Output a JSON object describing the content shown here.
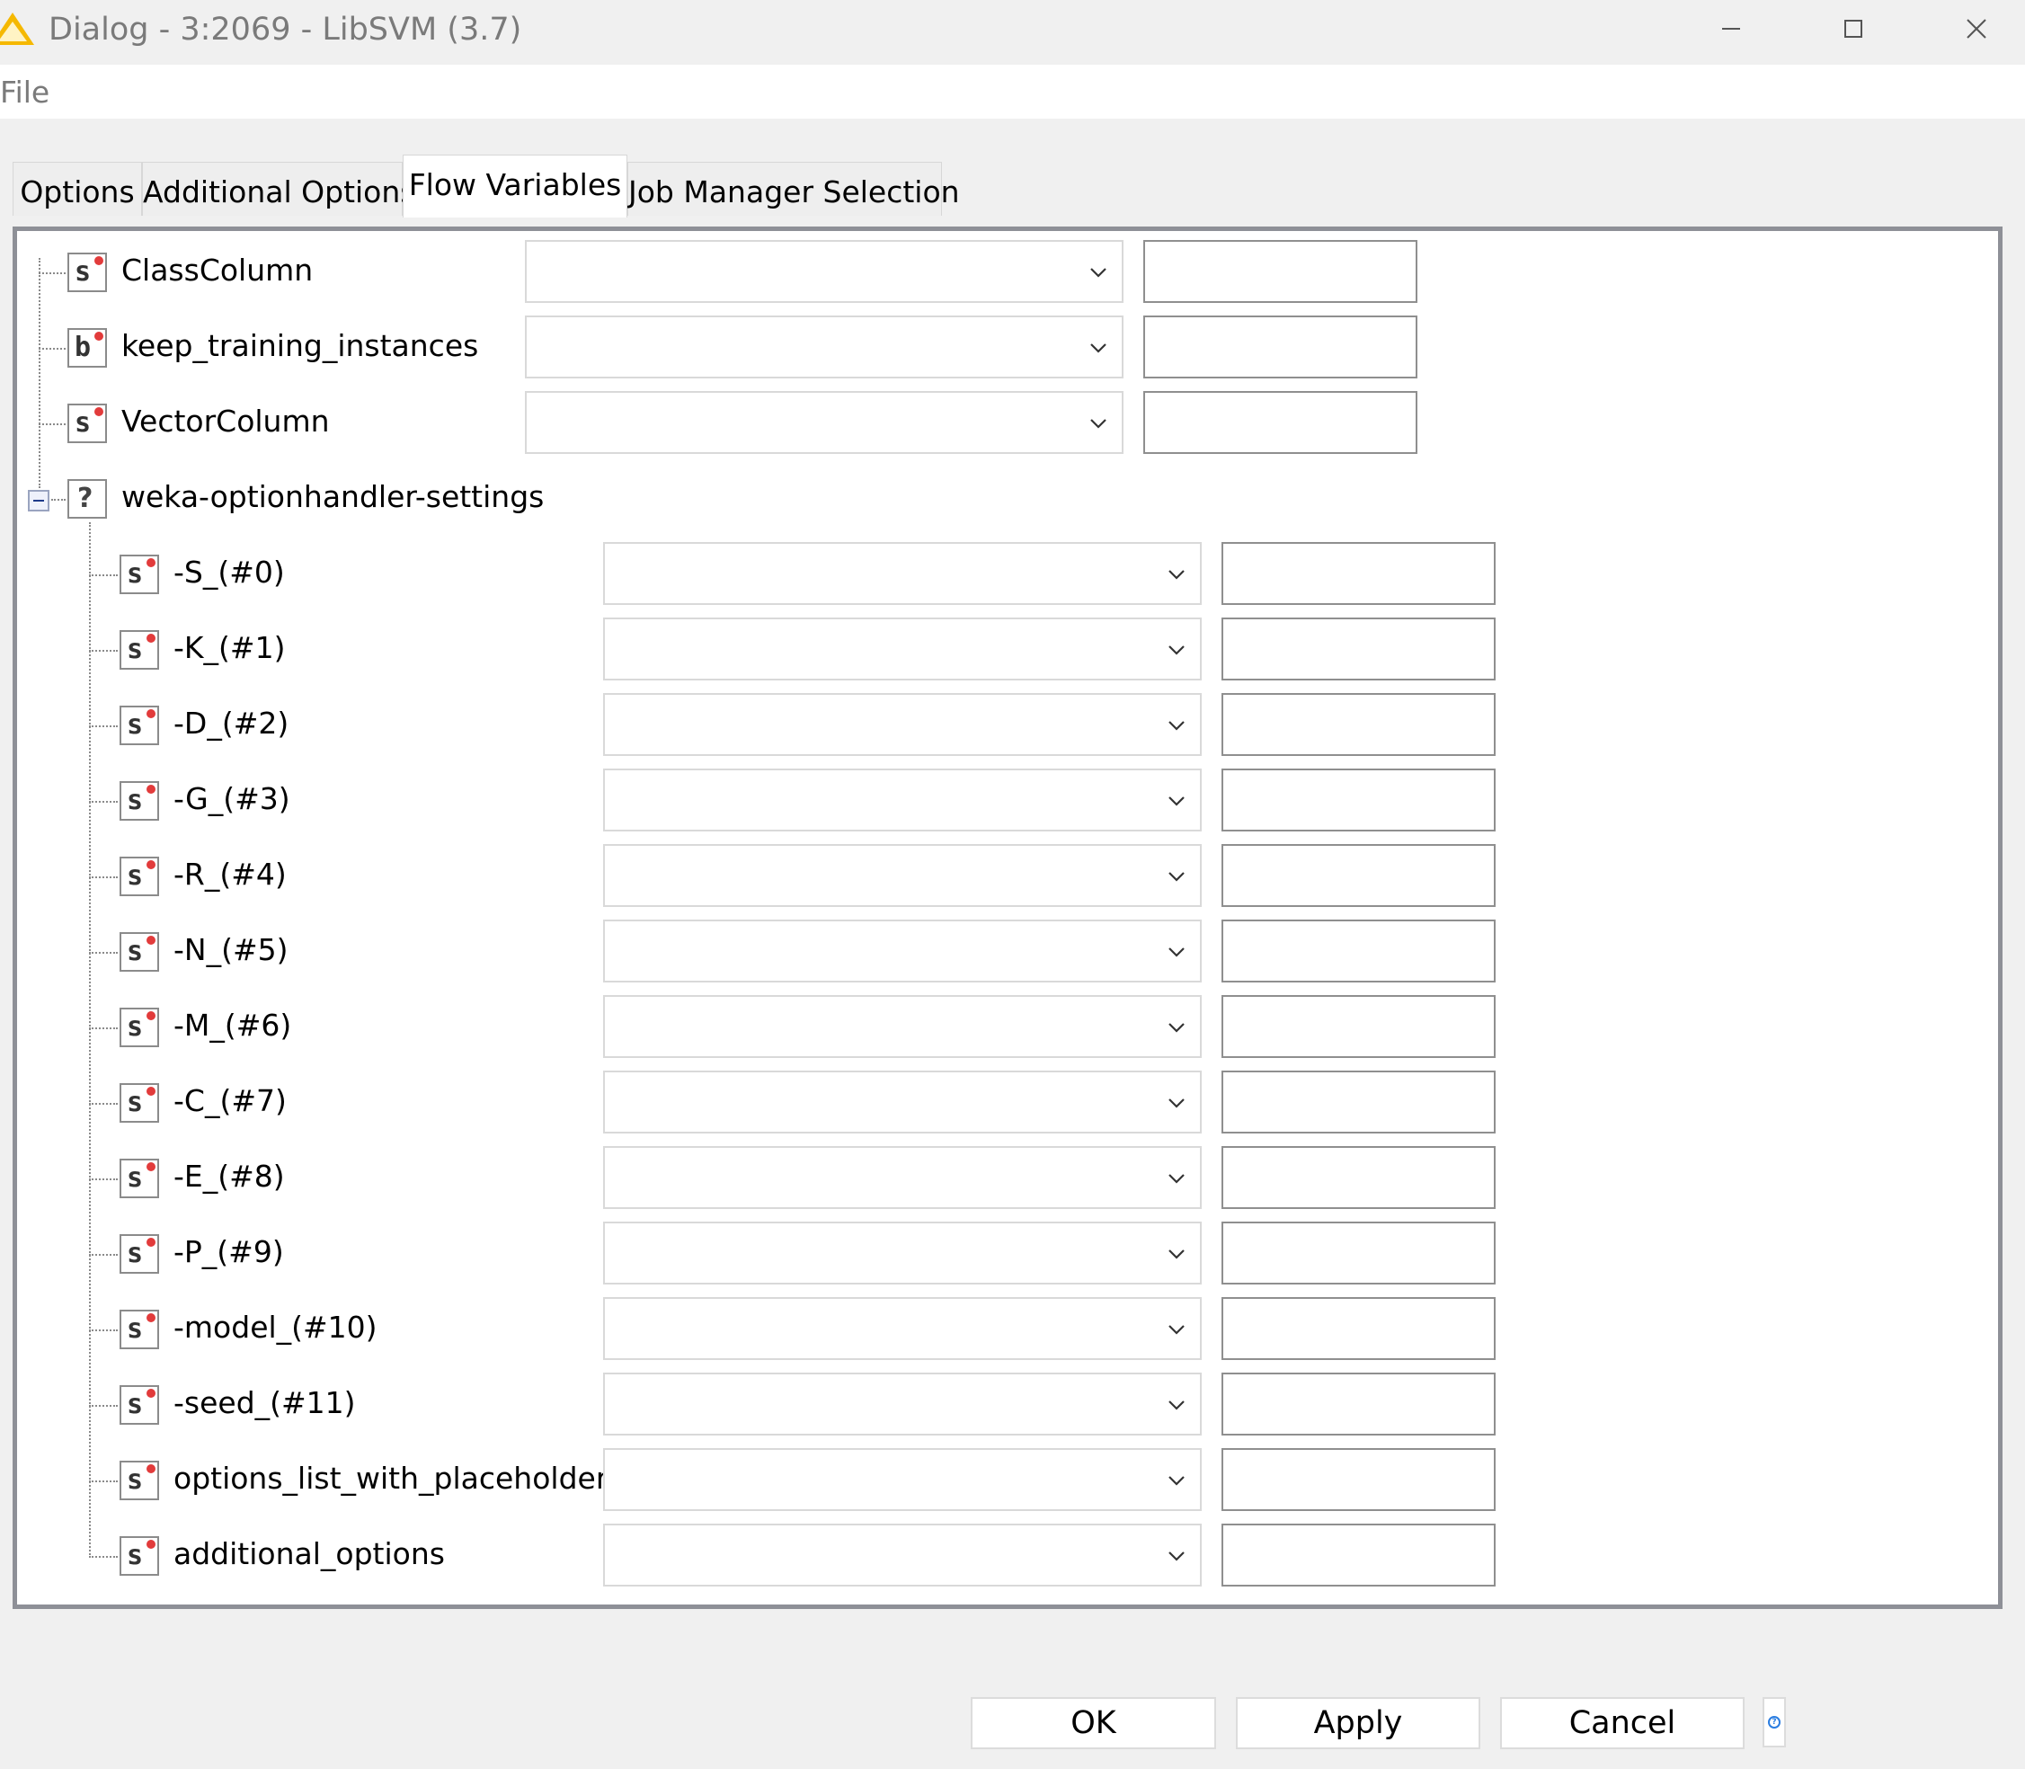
{
  "window": {
    "title": "Dialog - 3:2069 - LibSVM (3.7)",
    "icon": "warning-triangle-icon"
  },
  "menubar": {
    "file_label": "File"
  },
  "tabs": [
    {
      "label": "Options",
      "active": false
    },
    {
      "label": "Additional Options",
      "active": false
    },
    {
      "label": "Flow Variables",
      "active": true
    },
    {
      "label": "Job Manager Selection",
      "active": false
    }
  ],
  "tree": {
    "top_items": [
      {
        "type": "s",
        "label": "ClassColumn",
        "selected": "",
        "value": ""
      },
      {
        "type": "b",
        "label": "keep_training_instances",
        "selected": "",
        "value": ""
      },
      {
        "type": "s",
        "label": "VectorColumn",
        "selected": "",
        "value": ""
      }
    ],
    "group": {
      "type": "?",
      "label": "weka-optionhandler-settings",
      "expanded": true
    },
    "group_items": [
      {
        "type": "s",
        "label": "-S_(#0)",
        "selected": "",
        "value": ""
      },
      {
        "type": "s",
        "label": "-K_(#1)",
        "selected": "",
        "value": ""
      },
      {
        "type": "s",
        "label": "-D_(#2)",
        "selected": "",
        "value": ""
      },
      {
        "type": "s",
        "label": "-G_(#3)",
        "selected": "",
        "value": ""
      },
      {
        "type": "s",
        "label": "-R_(#4)",
        "selected": "",
        "value": ""
      },
      {
        "type": "s",
        "label": "-N_(#5)",
        "selected": "",
        "value": ""
      },
      {
        "type": "s",
        "label": "-M_(#6)",
        "selected": "",
        "value": ""
      },
      {
        "type": "s",
        "label": "-C_(#7)",
        "selected": "",
        "value": ""
      },
      {
        "type": "s",
        "label": "-E_(#8)",
        "selected": "",
        "value": ""
      },
      {
        "type": "s",
        "label": "-P_(#9)",
        "selected": "",
        "value": ""
      },
      {
        "type": "s",
        "label": "-model_(#10)",
        "selected": "",
        "value": ""
      },
      {
        "type": "s",
        "label": "-seed_(#11)",
        "selected": "",
        "value": ""
      },
      {
        "type": "s",
        "label": "options_list_with_placeholders",
        "selected": "",
        "value": ""
      },
      {
        "type": "s",
        "label": "additional_options",
        "selected": "",
        "value": ""
      }
    ]
  },
  "buttons": {
    "ok": "OK",
    "apply": "Apply",
    "cancel": "Cancel",
    "help_icon": "help-icon"
  },
  "colors": {
    "panel_border": "#8e9097",
    "variable_dot": "#e23b3b",
    "warning_icon": "#f5b800"
  }
}
